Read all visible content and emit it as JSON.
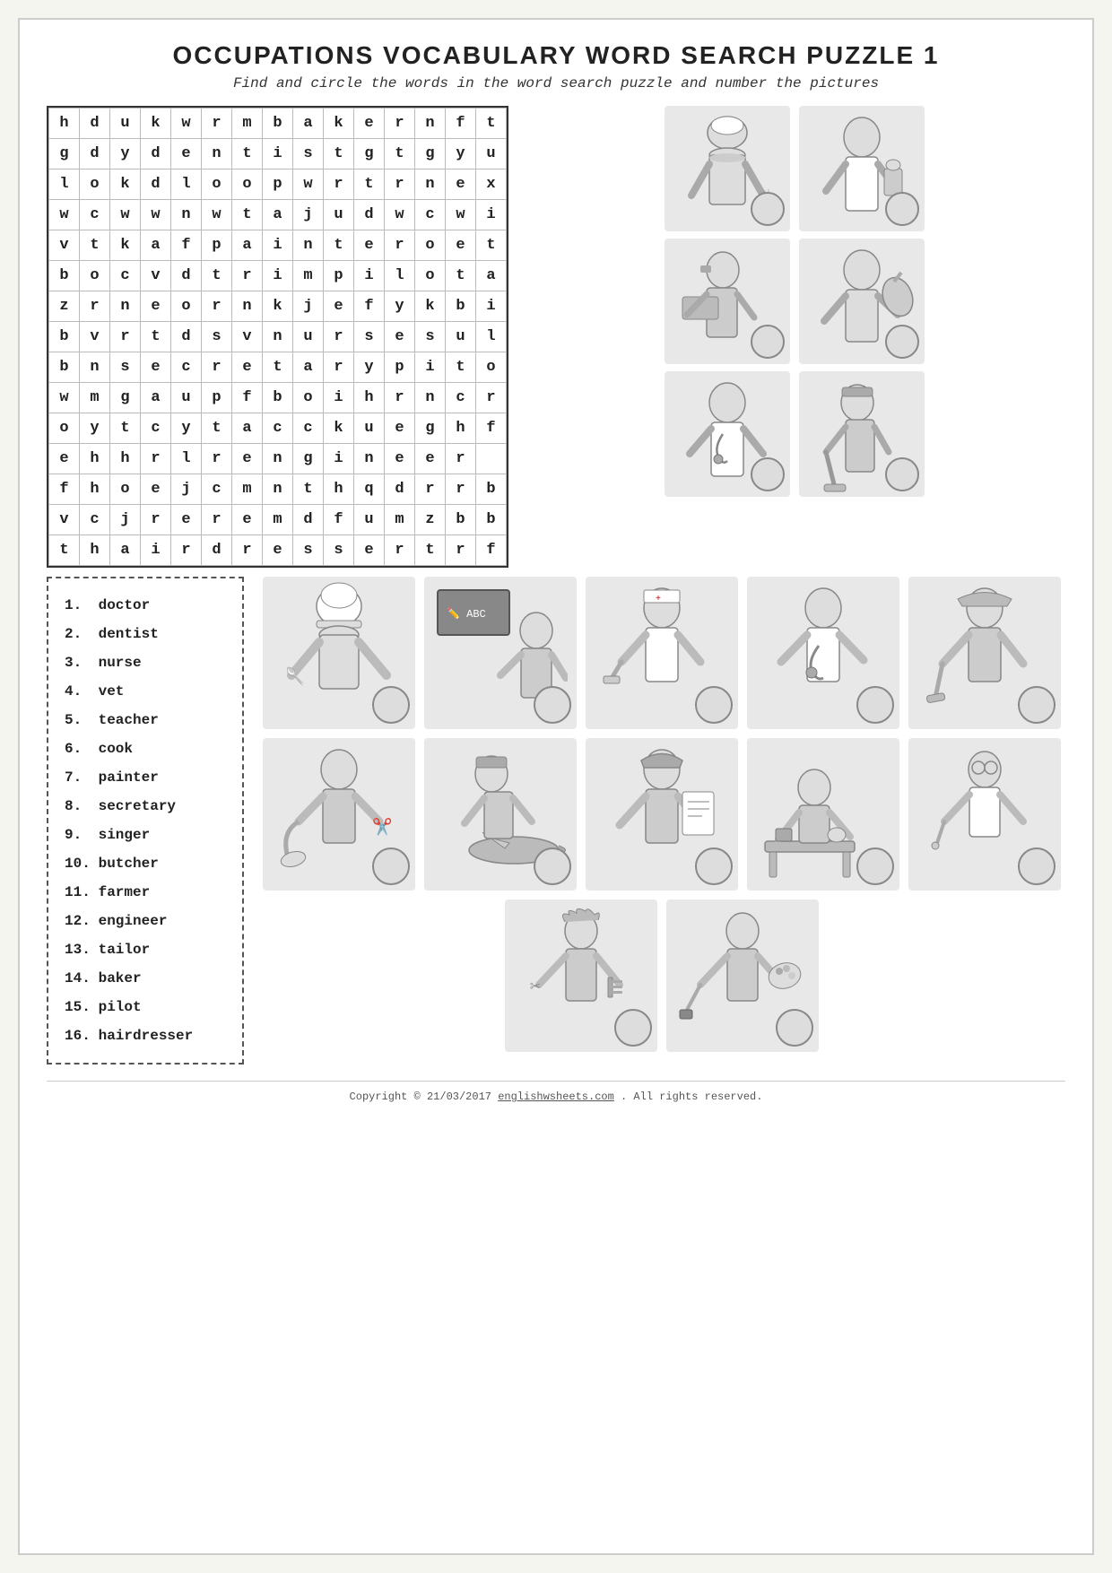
{
  "title": "OCCUPATIONS VOCABULARY WORD SEARCH PUZZLE 1",
  "subtitle": "Find and circle the words in the word search puzzle and number the pictures",
  "puzzle": {
    "rows": [
      [
        "h",
        "d",
        "u",
        "k",
        "w",
        "r",
        "m",
        "b",
        "a",
        "k",
        "e",
        "r",
        "n",
        "f",
        "t"
      ],
      [
        "g",
        "d",
        "y",
        "d",
        "e",
        "n",
        "t",
        "i",
        "s",
        "t",
        "g",
        "t",
        "g",
        "y",
        "u"
      ],
      [
        "l",
        "o",
        "k",
        "d",
        "l",
        "o",
        "o",
        "p",
        "w",
        "r",
        "t",
        "r",
        "n",
        "e",
        "x"
      ],
      [
        "w",
        "c",
        "w",
        "w",
        "n",
        "w",
        "t",
        "a",
        "j",
        "u",
        "d",
        "w",
        "c",
        "w",
        "i"
      ],
      [
        "v",
        "t",
        "k",
        "a",
        "f",
        "p",
        "a",
        "i",
        "n",
        "t",
        "e",
        "r",
        "o",
        "e",
        "t"
      ],
      [
        "b",
        "o",
        "c",
        "v",
        "d",
        "t",
        "r",
        "i",
        "m",
        "p",
        "i",
        "l",
        "o",
        "t",
        "a"
      ],
      [
        "z",
        "r",
        "n",
        "e",
        "o",
        "r",
        "n",
        "k",
        "j",
        "e",
        "f",
        "y",
        "k",
        "b",
        "i"
      ],
      [
        "b",
        "v",
        "r",
        "t",
        "d",
        "s",
        "v",
        "n",
        "u",
        "r",
        "s",
        "e",
        "s",
        "u",
        "l"
      ],
      [
        "b",
        "n",
        "s",
        "e",
        "c",
        "r",
        "e",
        "t",
        "a",
        "r",
        "y",
        "p",
        "i",
        "t",
        "o"
      ],
      [
        "w",
        "m",
        "g",
        "a",
        "u",
        "p",
        "f",
        "b",
        "o",
        "i",
        "h",
        "r",
        "n",
        "c",
        "r"
      ],
      [
        "o",
        "y",
        "t",
        "c",
        "y",
        "t",
        "a",
        "c",
        "c",
        "k",
        "u",
        "e",
        "g",
        "h",
        "f"
      ],
      [
        "e",
        "h",
        "h",
        "r",
        "l",
        "r",
        "e",
        "n",
        "g",
        "i",
        "n",
        "e",
        "e",
        "r",
        ""
      ],
      [
        "f",
        "h",
        "o",
        "e",
        "j",
        "c",
        "m",
        "n",
        "t",
        "h",
        "q",
        "d",
        "r",
        "r",
        "b"
      ],
      [
        "v",
        "c",
        "j",
        "r",
        "e",
        "r",
        "e",
        "m",
        "d",
        "f",
        "u",
        "m",
        "z",
        "b",
        "b"
      ],
      [
        "t",
        "h",
        "a",
        "i",
        "r",
        "d",
        "r",
        "e",
        "s",
        "s",
        "e",
        "r",
        "t",
        "r",
        "f"
      ]
    ]
  },
  "word_list": {
    "items": [
      {
        "num": "1.",
        "word": "doctor"
      },
      {
        "num": "2.",
        "word": "dentist"
      },
      {
        "num": "3.",
        "word": "nurse"
      },
      {
        "num": "4.",
        "word": "vet"
      },
      {
        "num": "5.",
        "word": "teacher"
      },
      {
        "num": "6.",
        "word": "cook"
      },
      {
        "num": "7.",
        "word": "painter"
      },
      {
        "num": "8.",
        "word": "secretary"
      },
      {
        "num": "9.",
        "word": "singer"
      },
      {
        "num": "10.",
        "word": "butcher"
      },
      {
        "num": "11.",
        "word": "farmer"
      },
      {
        "num": "12.",
        "word": "engineer"
      },
      {
        "num": "13.",
        "word": "tailor"
      },
      {
        "num": "14.",
        "word": "baker"
      },
      {
        "num": "15.",
        "word": "pilot"
      },
      {
        "num": "16.",
        "word": "hairdresser"
      }
    ]
  },
  "footer": {
    "copyright": "Copyright © 21/03/2017",
    "website": "englishwsheets.com",
    "rights": ". All rights reserved."
  },
  "figures": {
    "top_right": [
      {
        "label": "chef/cook",
        "emoji": "👨‍🍳"
      },
      {
        "label": "scientist",
        "emoji": "👩‍🔬"
      },
      {
        "label": "secretary",
        "emoji": "👩‍💼"
      },
      {
        "label": "butcher",
        "emoji": "🥩"
      },
      {
        "label": "doctor",
        "emoji": "👨‍⚕️"
      },
      {
        "label": "janitor",
        "emoji": "🧹"
      }
    ],
    "bottom": [
      {
        "label": "cook",
        "emoji": "👨‍🍳"
      },
      {
        "label": "teacher",
        "emoji": "👩‍🏫"
      },
      {
        "label": "nurse",
        "emoji": "👩‍⚕️"
      },
      {
        "label": "doctor",
        "emoji": "👨‍⚕️"
      },
      {
        "label": "worker",
        "emoji": "👷"
      },
      {
        "label": "tailor",
        "emoji": "🧵"
      },
      {
        "label": "farmer",
        "emoji": "👨‍🌾"
      },
      {
        "label": "engineer",
        "emoji": "✈️"
      },
      {
        "label": "baker",
        "emoji": "🍞"
      },
      {
        "label": "dentist",
        "emoji": "🦷"
      },
      {
        "label": "hairdresser",
        "emoji": "💇"
      },
      {
        "label": "painter",
        "emoji": "🎨"
      }
    ]
  }
}
